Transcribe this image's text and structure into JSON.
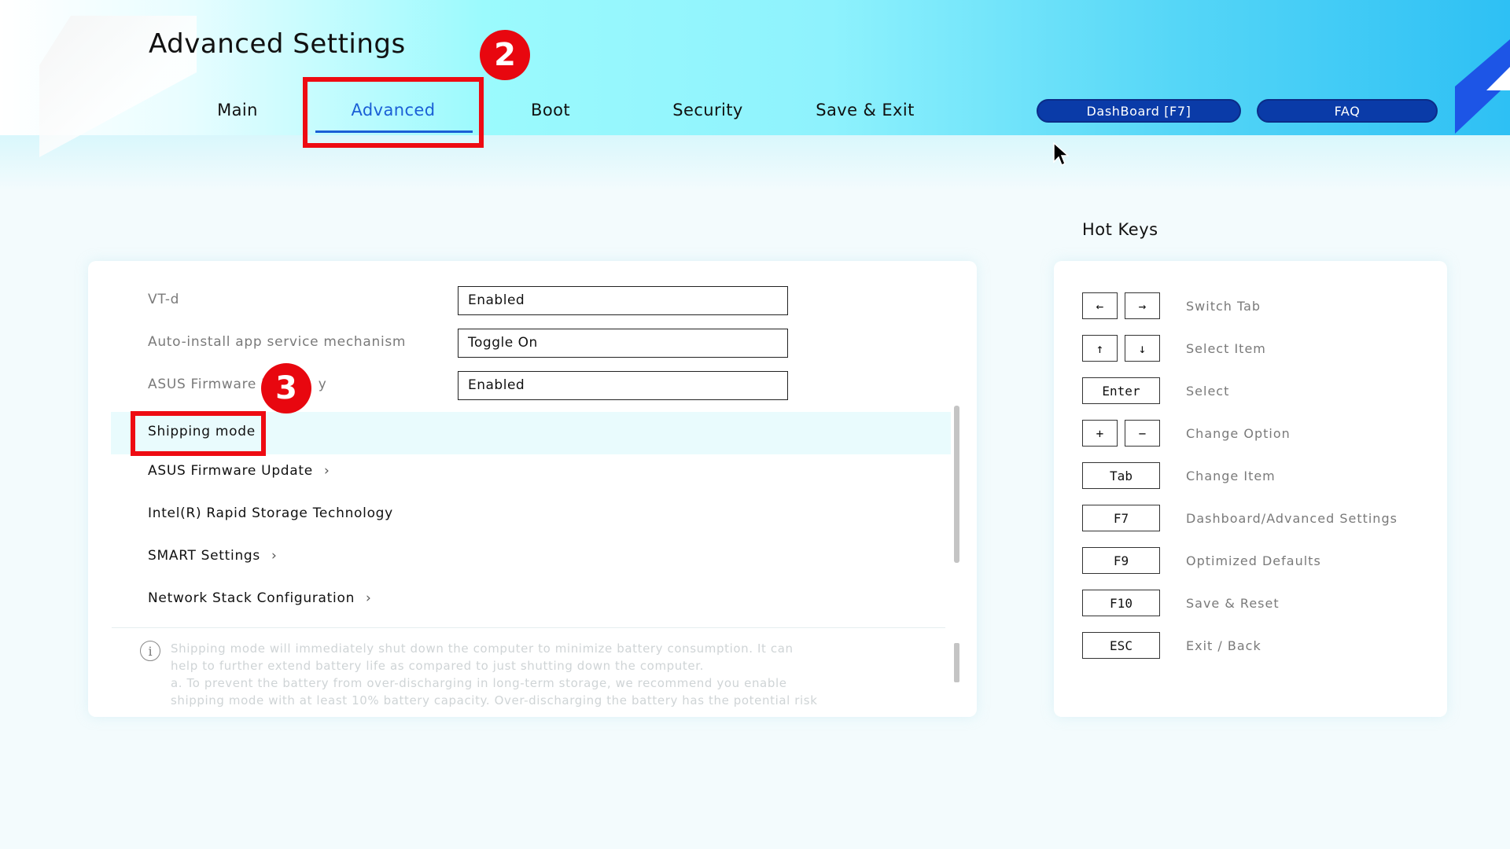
{
  "app": {
    "title": "Advanced Settings"
  },
  "tabs": [
    {
      "label": "Main"
    },
    {
      "label": "Advanced",
      "active": true
    },
    {
      "label": "Boot"
    },
    {
      "label": "Security"
    },
    {
      "label": "Save & Exit"
    }
  ],
  "header_buttons": {
    "dashboard": "DashBoard [F7]",
    "faq": "FAQ"
  },
  "annotations": {
    "badge_tab": "2",
    "badge_item": "3"
  },
  "settings": [
    {
      "label": "VT-d",
      "value": "Enabled"
    },
    {
      "label": "Auto-install app service mechanism",
      "value": "Toggle On"
    },
    {
      "label": "ASUS Firmware R",
      "label_suffix": "y",
      "value": "Enabled"
    },
    {
      "label": "Shipping mode",
      "selected": true
    },
    {
      "label": "ASUS Firmware Update",
      "submenu": true
    },
    {
      "label": "Intel(R) Rapid Storage Technology"
    },
    {
      "label": "SMART Settings",
      "submenu": true
    },
    {
      "label": "Network Stack Configuration",
      "submenu": true
    }
  ],
  "help": {
    "icon": "info-icon",
    "lines": [
      "Shipping mode will immediately shut down the computer to minimize battery consumption. It can",
      "help to further extend battery life as compared to just shutting down the computer.",
      "a. To prevent the battery from over-discharging in long-term storage, we recommend you enable",
      "shipping mode with at least 10% battery capacity. Over-discharging the battery has the potential risk"
    ]
  },
  "hotkeys": {
    "title": "Hot Keys",
    "items": [
      {
        "keys": [
          "←",
          "→"
        ],
        "desc": "Switch Tab"
      },
      {
        "keys": [
          "↑",
          "↓"
        ],
        "desc": "Select Item"
      },
      {
        "keys": [
          "Enter"
        ],
        "desc": "Select"
      },
      {
        "keys": [
          "+",
          "−"
        ],
        "desc": "Change Option"
      },
      {
        "keys": [
          "Tab"
        ],
        "desc": "Change Item"
      },
      {
        "keys": [
          "F7"
        ],
        "desc": "Dashboard/Advanced Settings"
      },
      {
        "keys": [
          "F9"
        ],
        "desc": "Optimized Defaults"
      },
      {
        "keys": [
          "F10"
        ],
        "desc": "Save & Reset"
      },
      {
        "keys": [
          "ESC"
        ],
        "desc": "Exit / Back"
      }
    ]
  },
  "colors": {
    "accent": "#1a5fd6",
    "pill": "#0a3ba8",
    "annotation_red": "#ee0b12",
    "highlight": "#e9fbfd"
  }
}
